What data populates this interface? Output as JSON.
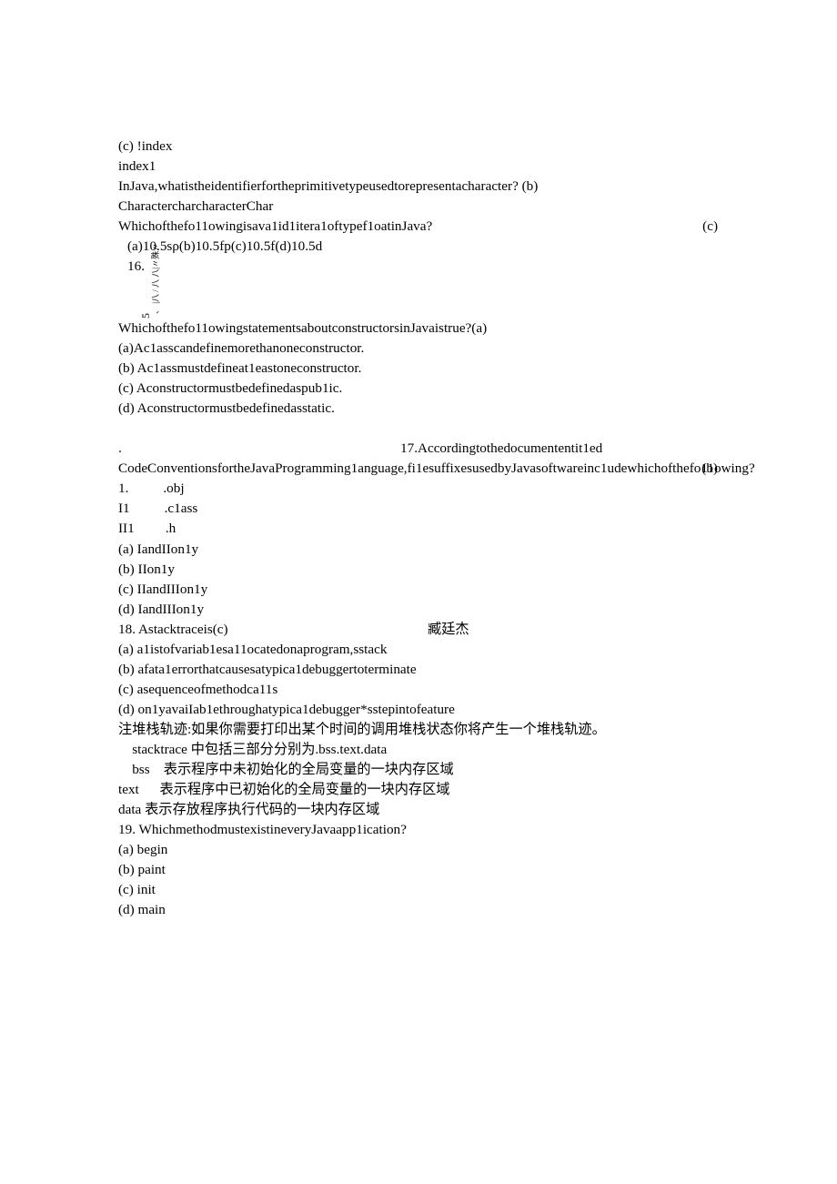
{
  "q13_c": "(c)  !index",
  "q13_d": "index1",
  "q14_text": "InJava,whatistheidentifierfortheprimitivetypeusedtorepresentacharacter?  (b)",
  "q14_options": "CharactercharcharacterChar",
  "q15_line": "Whichofthefo11owingisava1id1itera1oftypef1oatinJava?",
  "q15_answer": "(c)",
  "q15_options_l1": " (a)10.5sρ(b)10.5fp(c)10.5f(d)10.5d",
  "q15_options_l2": " 16.",
  "rotated_side": "、   |八 /  八 八|〃殊〃   ",
  "rotated_5": "5",
  "q16_text": "Whichofthefo11owingstatementsaboutconstructorsinJavaistrue?(a)(a)Ac1asscandefinemorethanoneconstructor.",
  "q16_b": "(b)  Ac1assmustdefineat1eastoneconstructor.",
  "q16_c": "(c)  Aconstructormustbedefinedaspub1ic.",
  "q16_d": "(d)  Aconstructormustbedefinedasstatic.",
  "q17_dot": ".",
  "q17_head": "17.Accordingtothedocumententit1ed",
  "q17_body": "CodeConventionsfortheJavaProgramming1anguage,fi1esuffixesusedbyJavasoftwareinc1udewhichofthefo11owing?",
  "q17_answer": "(b)",
  "q17_I": "1.          .obj",
  "q17_II": "I1          .c1ass",
  "q17_III": "II1         .h",
  "q17_a": "(a)  IandIIon1y",
  "q17_b": "(b)  IIon1y",
  "q17_c": "(c)  IIandIIIon1y",
  "q17_d": "(d)  IandIIIon1y",
  "q18_head": "18.  Astacktraceis(c)",
  "q18_name": "臧廷杰",
  "q18_a": "(a)  a1istofvariab1esa11ocatedonaprogram,sstack",
  "q18_b": "(b)  afata1errorthatcausesatypica1debuggertoterminate",
  "q18_c": "(c)  asequenceofmethodca11s",
  "q18_d": "(d)  on1yavaiIab1ethroughatypica1debugger*sstepintofeature",
  "note1": "注堆栈轨迹:如果你需要打印出某个时间的调用堆栈状态你将产生一个堆栈轨迹。",
  "note2": "    stacktrace 中包括三部分分别为.bss.text.data",
  "note3": "    bss    表示程序中未初始化的全局变量的一块内存区域",
  "note4": "text      表示程序中已初始化的全局变量的一块内存区域",
  "note5": "data 表示存放程序执行代码的一块内存区域",
  "q19_head": "19.  WhichmethodmustexistineveryJavaapp1ication?",
  "q19_a": "(a)   begin",
  "q19_b": "(b)   paint",
  "q19_c": "(c)   init",
  "q19_d": "(d)   main"
}
